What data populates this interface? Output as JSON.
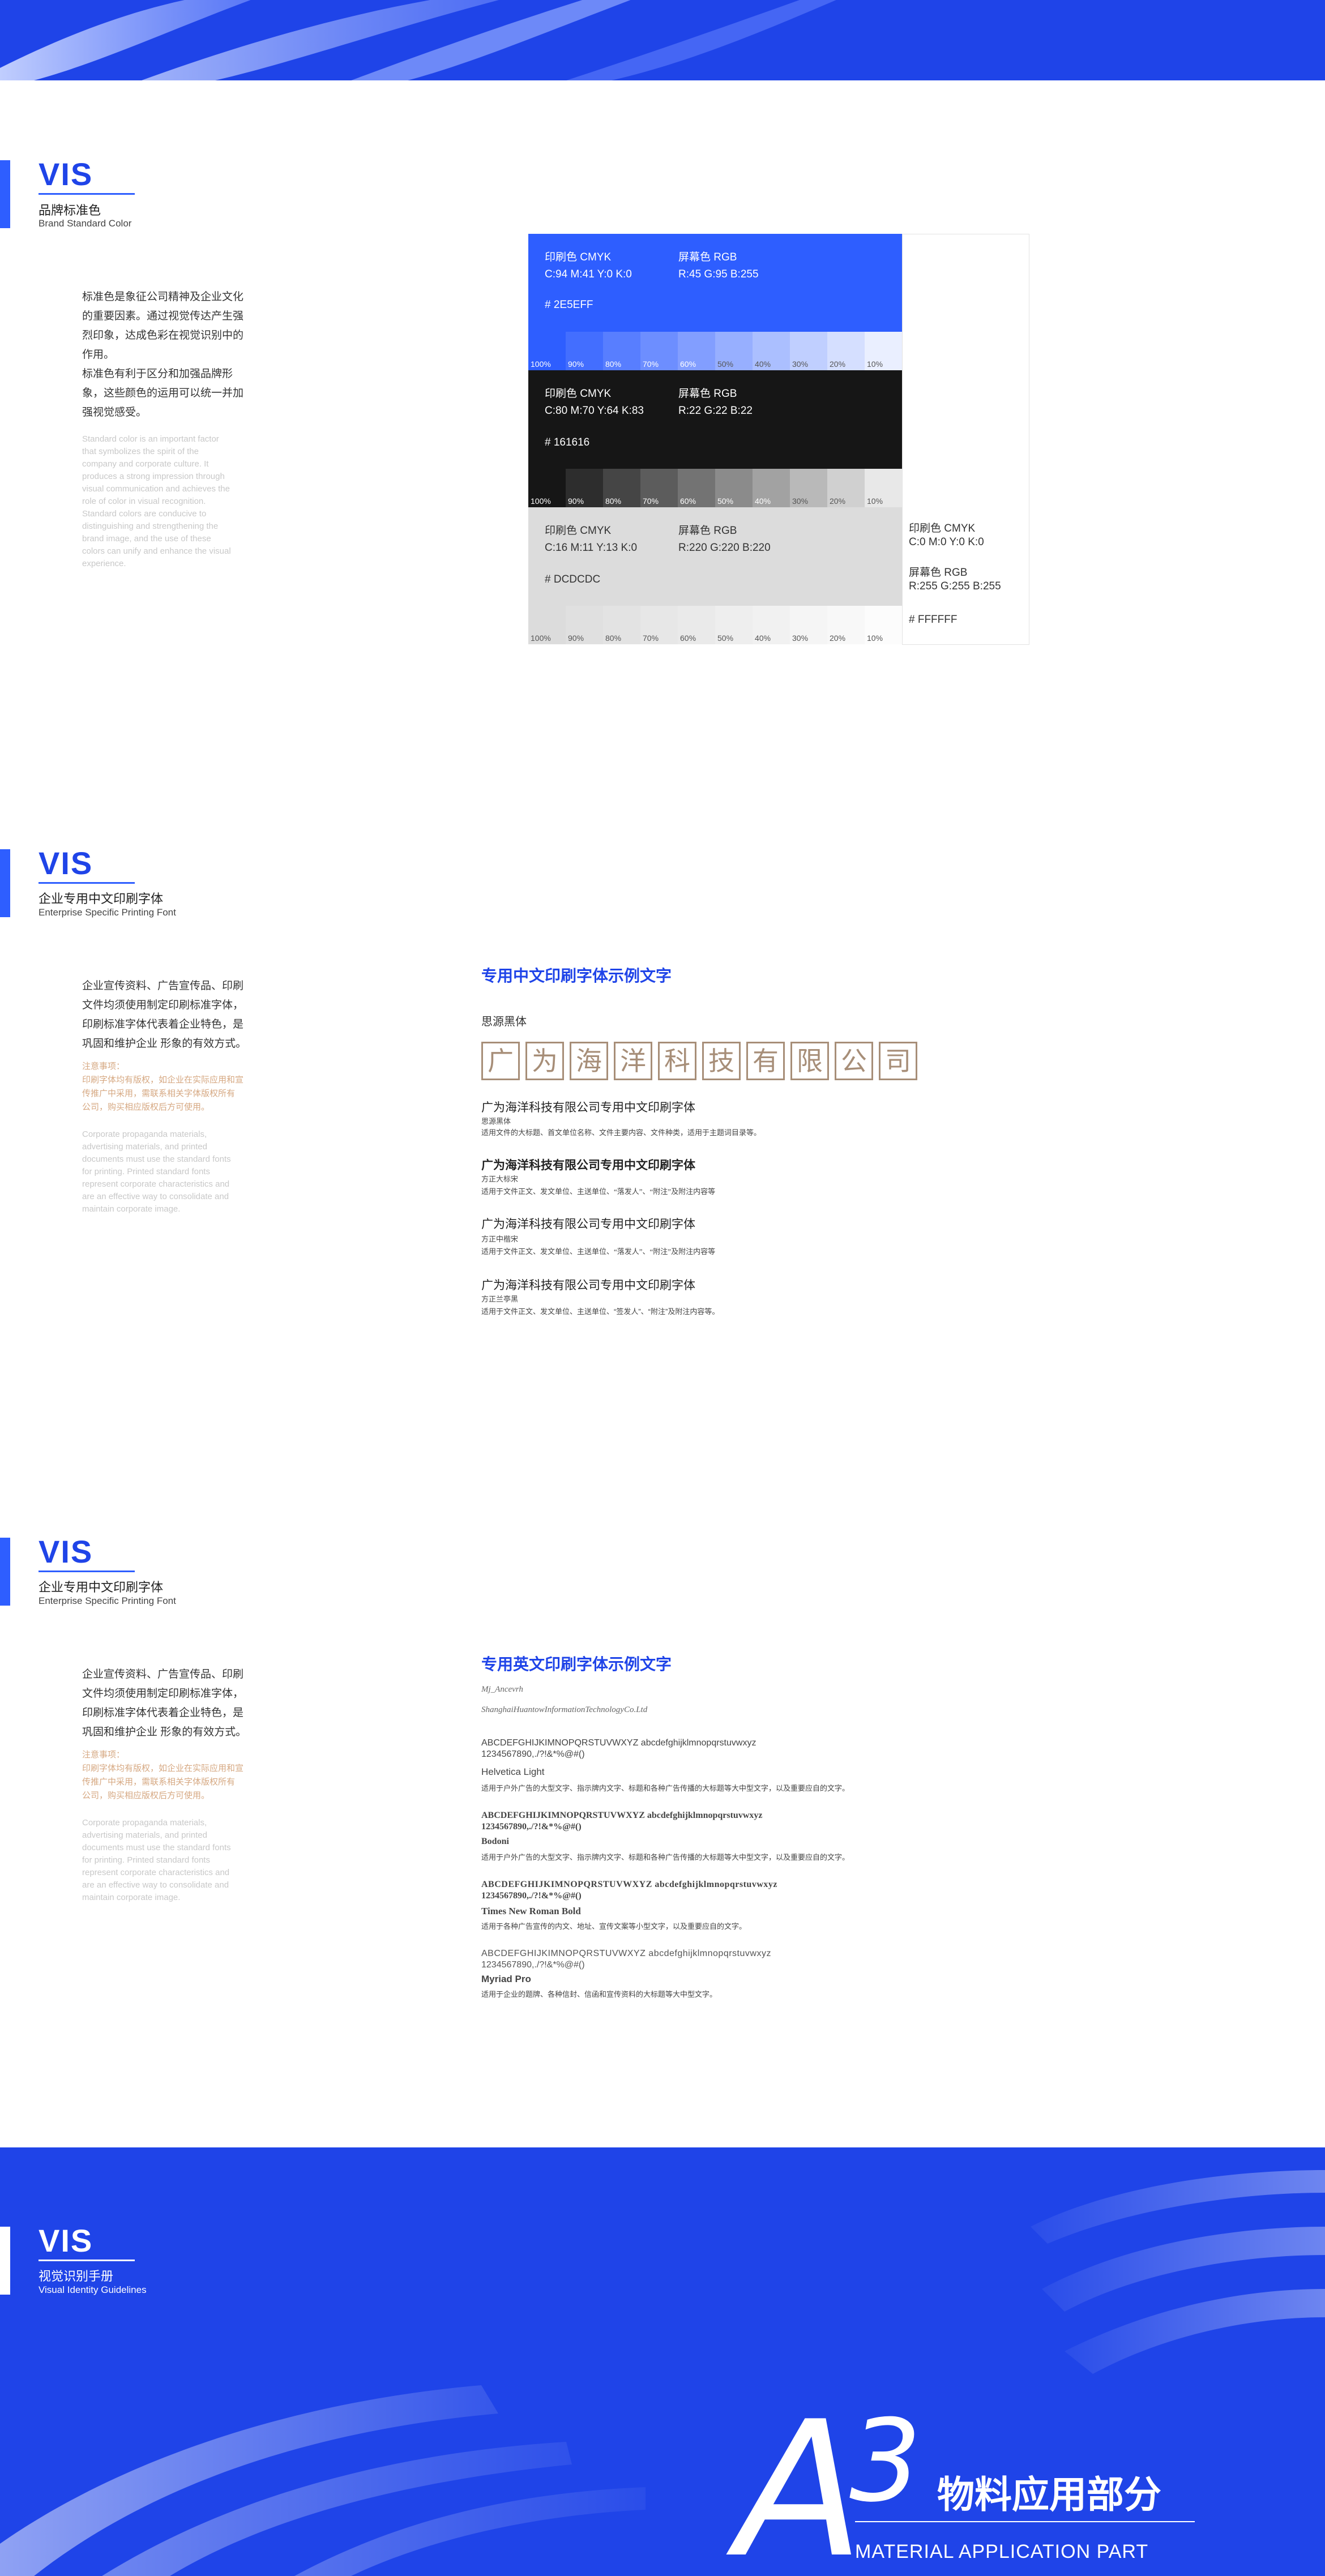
{
  "colors": {
    "brand_blue": "#2E5EFF",
    "brand_black": "#161616",
    "brand_gray": "#DCDCDC",
    "brand_white": "#FFFFFF",
    "accent_brown": "#A78E78"
  },
  "section1": {
    "vis": "VIS",
    "title_cn": "品牌标准色",
    "title_en": "Brand Standard Color",
    "intro_cn": [
      "标准色是象征公司精神及企业文化",
      "的重要因素。通过视觉传达产生强",
      "烈印象，达成色彩在视觉识别中的",
      "作用。",
      "标准色有利于区分和加强品牌形",
      "象，这些颜色的运用可以统一并加",
      "强视觉感受。"
    ],
    "intro_en": [
      "Standard color is an important factor",
      "that symbolizes the spirit of the",
      "company and corporate culture. It",
      "produces a strong impression through",
      "visual communication and achieves the",
      "role of color in visual recognition.",
      "Standard colors are conducive to",
      "distinguishing and strengthening the",
      "brand image, and the use of these",
      "colors can unify and enhance the visual",
      "experience."
    ],
    "swatches": [
      {
        "cmyk_label": "印刷色 CMYK",
        "cmyk": "C:94  M:41  Y:0  K:0",
        "rgb_label": "屏幕色 RGB",
        "rgb": "R:45  G:95  B:255",
        "hex": "# 2E5EFF"
      },
      {
        "cmyk_label": "印刷色 CMYK",
        "cmyk": "C:80  M:70  Y:64  K:83",
        "rgb_label": "屏幕色 RGB",
        "rgb": "R:22  G:22  B:22",
        "hex": "# 161616"
      },
      {
        "cmyk_label": "印刷色 CMYK",
        "cmyk": "C:16  M:11  Y:13  K:0",
        "rgb_label": "屏幕色 RGB",
        "rgb": "R:220  G:220  B:220",
        "hex": "# DCDCDC"
      },
      {
        "cmyk_label": "印刷色 CMYK",
        "cmyk": "C:0  M:0  Y:0  K:0",
        "rgb_label": "屏幕色 RGB",
        "rgb": "R:255  G:255  B:255",
        "hex": "# FFFFFF"
      }
    ],
    "tints": [
      "100%",
      "90%",
      "80%",
      "70%",
      "60%",
      "50%",
      "40%",
      "30%",
      "20%",
      "10%"
    ]
  },
  "section2": {
    "vis": "VIS",
    "title_cn": "企业专用中文印刷字体",
    "title_en": "Enterprise Specific Printing Font",
    "intro_cn": [
      "企业宣传资料、广告宣传品、印刷",
      "文件均须使用制定印刷标准字体，",
      "印刷标准字体代表着企业特色，是",
      "巩固和维护企业 形象的有效方式。"
    ],
    "note": [
      "注意事项：",
      "印刷字体均有版权，如企业在实际应用和宣",
      "传推广中采用，需联系相关字体版权所有",
      "公司，购买相应版权后方可使用。"
    ],
    "intro_en": [
      "Corporate propaganda materials,",
      "advertising materials, and printed",
      "documents must use the standard fonts",
      "for printing. Printed standard fonts",
      "represent corporate characteristics and",
      "are an effective way to consolidate and",
      "maintain corporate image."
    ],
    "heading": "专用中文印刷字体示例文字",
    "sample_font": "思源黑体",
    "sample_chars": [
      "广",
      "为",
      "海",
      "洋",
      "科",
      "技",
      "有",
      "限",
      "公",
      "司"
    ],
    "fonts": [
      {
        "title": "广为海洋科技有限公司专用中文印刷字体",
        "name": "思源黑体",
        "desc": "适用文件的大标题、首文单位名称、文件主要内容、文件种类，适用于主题词目录等。"
      },
      {
        "title": "广为海洋科技有限公司专用中文印刷字体",
        "name": "方正大标宋",
        "desc": "适用于文件正文、发文单位、主送单位、“落发人”、“附注”及附注内容等"
      },
      {
        "title": "广为海洋科技有限公司专用中文印刷字体",
        "name": "方正中楷宋",
        "desc": "适用于文件正文、发文单位、主送单位、“落发人”、“附注”及附注内容等"
      },
      {
        "title": "广为海洋科技有限公司专用中文印刷字体",
        "name": "方正兰亭黑",
        "desc": "适用于文件正文、发文单位、主送单位、“签发人”、“附注”及附注内容等。"
      }
    ]
  },
  "section3": {
    "vis": "VIS",
    "title_cn": "企业专用中文印刷字体",
    "title_en": "Enterprise Specific Printing Font",
    "intro_cn": [
      "企业宣传资料、广告宣传品、印刷",
      "文件均须使用制定印刷标准字体，",
      "印刷标准字体代表着企业特色，是",
      "巩固和维护企业 形象的有效方式。"
    ],
    "note": [
      "注意事项：",
      "印刷字体均有版权，如企业在实际应用和宣",
      "传推广中采用，需联系相关字体版权所有",
      "公司，购买相应版权后方可使用。"
    ],
    "intro_en": [
      "Corporate propaganda materials,",
      "advertising materials, and printed",
      "documents must use the standard fonts",
      "for printing. Printed standard fonts",
      "represent corporate characteristics and",
      "are an effective way to consolidate and",
      "maintain corporate image."
    ],
    "heading": "专用英文印刷字体示例文字",
    "script_line1": "Mj_Ancevrh",
    "script_line2": "ShanghaiHuantowInformationTechnologyCo.Ltd",
    "fonts": [
      {
        "alphabet": "ABCDEFGHIJKIMNOPQRSTUVWXYZ abcdefghijklmnopqrstuvwxyz",
        "digits": "1234567890,./?!&*%@#()",
        "name": "Helvetica Light",
        "desc": "适用于户外广告的大型文字、指示牌内文字、标题和各种广告传播的大标题等大中型文字，以及重要应自的文字。"
      },
      {
        "alphabet": "ABCDEFGHIJKIMNOPQRSTUVWXYZ abcdefghijklmnopqrstuvwxyz",
        "digits": "1234567890,./?!&*%@#()",
        "name": "Bodoni",
        "desc": "适用于户外广告的大型文字、指示牌内文字、标题和各种广告传播的大标题等大中型文字，以及重要应自的文字。"
      },
      {
        "alphabet": "ABCDEFGHIJKIMNOPQRSTUVWXYZ abcdefghijklmnopqrstuvwxyz",
        "digits": "1234567890,./?!&*%@#()",
        "name": "Times New Roman Bold",
        "desc": "适用于各种广告宣传的内文、地址、宣传文案等小型文字，以及重要应自的文字。"
      },
      {
        "alphabet": "ABCDEFGHIJKIMNOPQRSTUVWXYZ abcdefghijklmnopqrstuvwxyz",
        "digits": "1234567890,./?!&*%@#()",
        "name": "Myriad Pro",
        "desc": "适用于企业的题牌、各种信封、信函和宣传资料的大标题等大中型文字。"
      }
    ]
  },
  "bottom": {
    "vis": "VIS",
    "title_cn": "视觉识别手册",
    "title_en": "Visual Identity Guidelines",
    "big_letter": "A",
    "big_number": "3",
    "part_cn": "物料应用部分",
    "part_en": "MATERIAL APPLICATION PART"
  }
}
